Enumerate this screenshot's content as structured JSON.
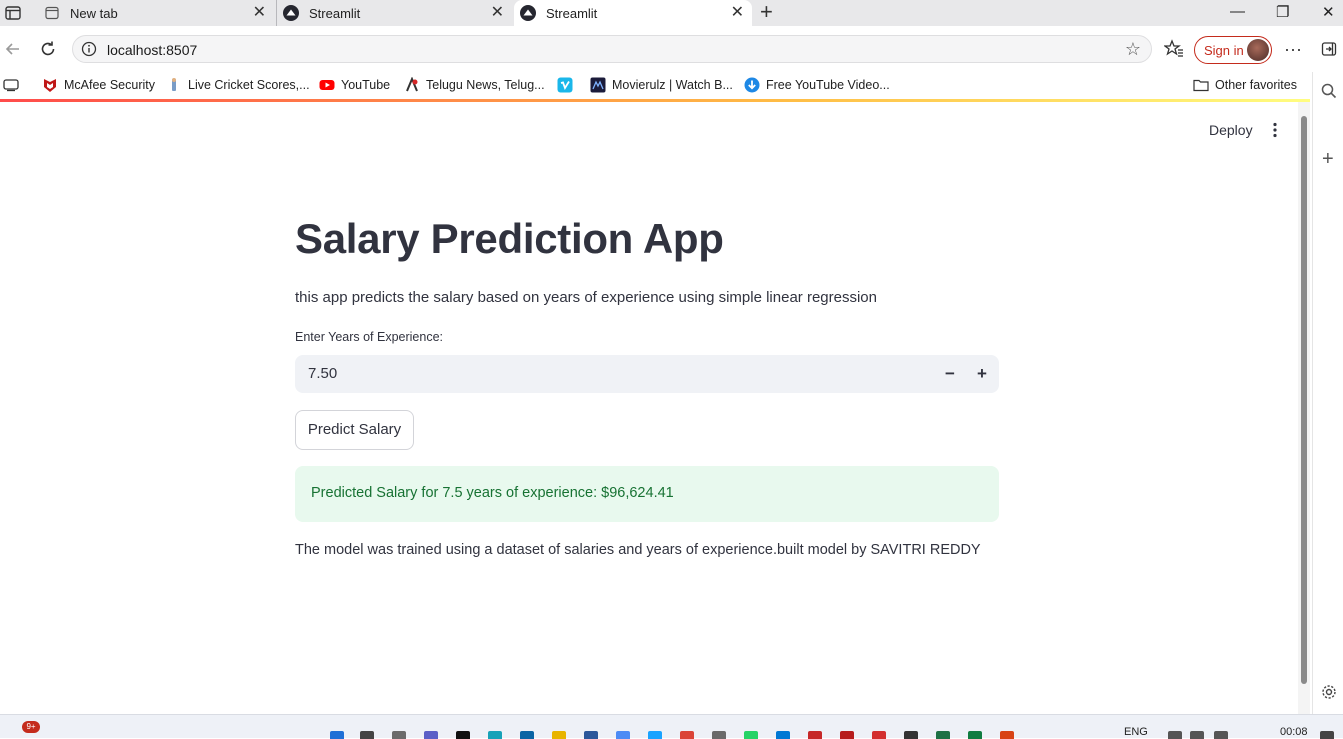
{
  "browser": {
    "tabs": [
      {
        "label": "New tab"
      },
      {
        "label": "Streamlit"
      },
      {
        "label": "Streamlit"
      }
    ],
    "url": "localhost:8507",
    "signin_label": "Sign in",
    "bookmarks": [
      {
        "label": "McAfee Security"
      },
      {
        "label": "Live Cricket Scores,..."
      },
      {
        "label": "YouTube"
      },
      {
        "label": "Telugu News, Telug..."
      },
      {
        "label": "Movierulz | Watch B..."
      },
      {
        "label": "Free YouTube Video..."
      }
    ],
    "other_favorites": "Other favorites"
  },
  "app": {
    "deploy_label": "Deploy",
    "title": "Salary Prediction App",
    "description": "this app predicts the salary based on years of experience using simple linear regression",
    "input_label": "Enter Years of Experience:",
    "input_value": "7.50",
    "decrement_label": "−",
    "increment_label": "+",
    "predict_button": "Predict Salary",
    "result": "Predicted Salary for 7.5 years of experience: $96,624.41",
    "footnote": "The model was trained using a dataset of salaries and years of experience.built model by SAVITRI REDDY"
  },
  "taskbar": {
    "notification_badge": "9+",
    "language": "ENG",
    "time": "00:08"
  },
  "colors": {
    "streamlit_red": "#ff4b4b",
    "success_bg": "#e8f9ee",
    "success_text": "#177233",
    "text_primary": "#31333f",
    "signin_red": "#c42b1c"
  }
}
